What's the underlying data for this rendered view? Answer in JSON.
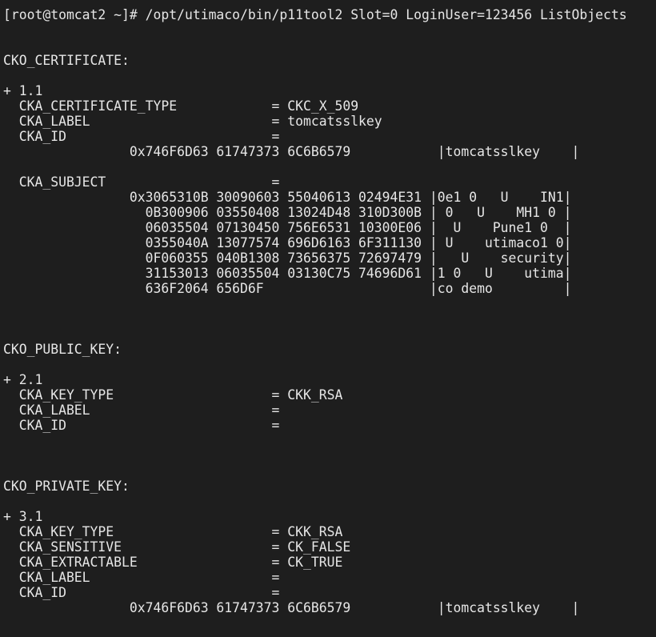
{
  "terminal": {
    "lines": [
      "[root@tomcat2 ~]# /opt/utimaco/bin/p11tool2 Slot=0 LoginUser=123456 ListObjects",
      "",
      "",
      "CKO_CERTIFICATE:",
      "",
      "+ 1.1",
      "  CKA_CERTIFICATE_TYPE            = CKC_X_509",
      "  CKA_LABEL                       = tomcatsslkey",
      "  CKA_ID                          =",
      "                0x746F6D63 61747373 6C6B6579           |tomcatsslkey    |",
      "",
      "  CKA_SUBJECT                     =",
      "                0x3065310B 30090603 55040613 02494E31 |0e1 0   U    IN1|",
      "                  0B300906 03550408 13024D48 310D300B | 0   U    MH1 0 |",
      "                  06035504 07130450 756E6531 10300E06 |  U    Pune1 0  |",
      "                  0355040A 13077574 696D6163 6F311130 | U    utimaco1 0|",
      "                  0F060355 040B1308 73656375 72697479 |   U    security|",
      "                  31153013 06035504 03130C75 74696D61 |1 0   U    utima|",
      "                  636F2064 656D6F                     |co demo         |",
      "",
      "",
      "",
      "CKO_PUBLIC_KEY:",
      "",
      "+ 2.1",
      "  CKA_KEY_TYPE                    = CKK_RSA",
      "  CKA_LABEL                       =",
      "  CKA_ID                          =",
      "",
      "",
      "",
      "CKO_PRIVATE_KEY:",
      "",
      "+ 3.1",
      "  CKA_KEY_TYPE                    = CKK_RSA",
      "  CKA_SENSITIVE                   = CK_FALSE",
      "  CKA_EXTRACTABLE                 = CK_TRUE",
      "  CKA_LABEL                       =",
      "  CKA_ID                          =",
      "                0x746F6D63 61747373 6C6B6579           |tomcatsslkey    |"
    ]
  }
}
